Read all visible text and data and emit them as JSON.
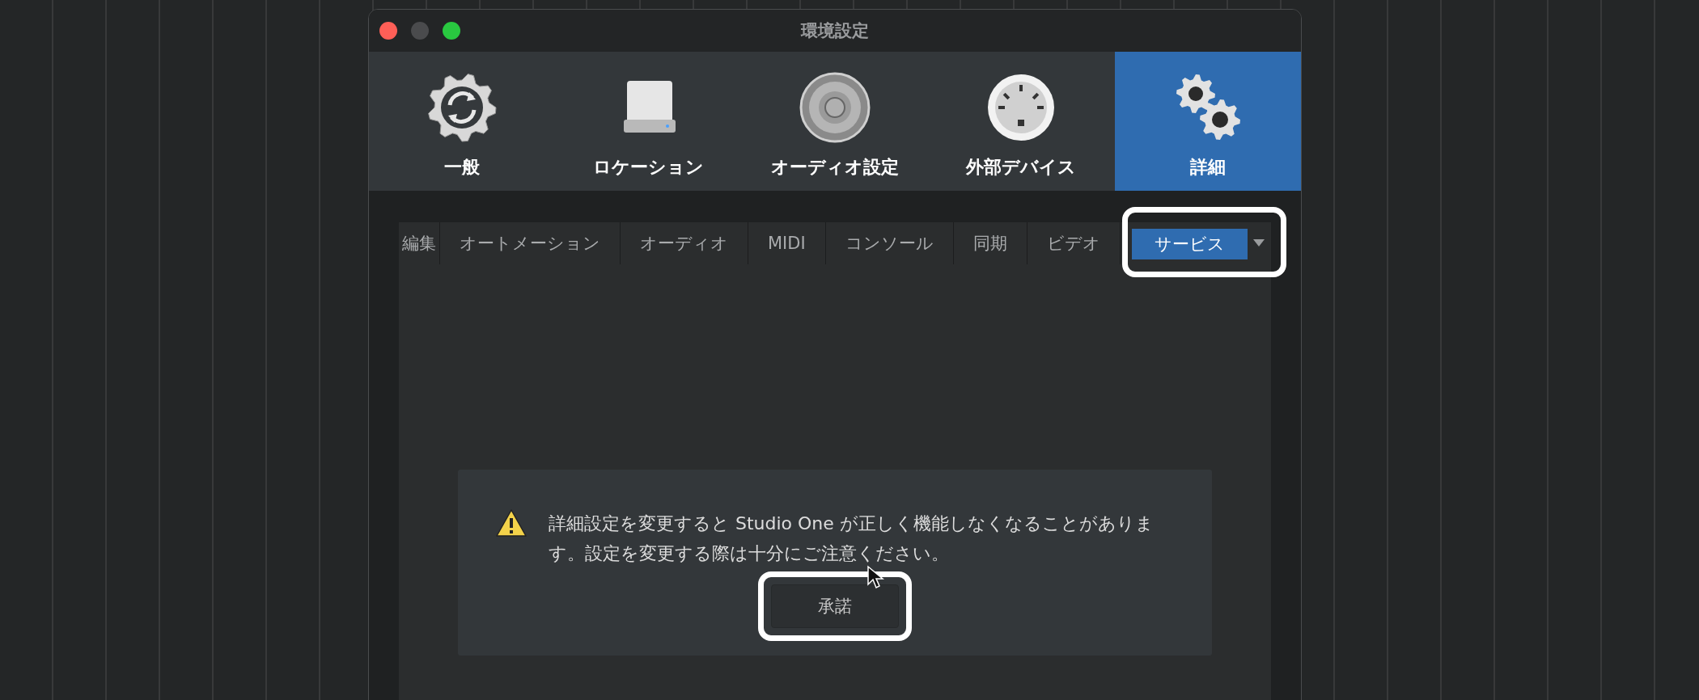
{
  "window": {
    "title": "環境設定"
  },
  "categories": [
    {
      "label": "一般",
      "kind": "general",
      "selected": false
    },
    {
      "label": "ロケーション",
      "kind": "locations",
      "selected": false
    },
    {
      "label": "オーディオ設定",
      "kind": "audio",
      "selected": false
    },
    {
      "label": "外部デバイス",
      "kind": "devices",
      "selected": false
    },
    {
      "label": "詳細",
      "kind": "advanced",
      "selected": true
    }
  ],
  "subtabs": [
    {
      "label": "編集",
      "selected": false,
      "highlighted": false
    },
    {
      "label": "オートメーション",
      "selected": false,
      "highlighted": false
    },
    {
      "label": "オーディオ",
      "selected": false,
      "highlighted": false
    },
    {
      "label": "MIDI",
      "selected": false,
      "highlighted": false
    },
    {
      "label": "コンソール",
      "selected": false,
      "highlighted": false
    },
    {
      "label": "同期",
      "selected": false,
      "highlighted": false
    },
    {
      "label": "ビデオ",
      "selected": false,
      "highlighted": false
    },
    {
      "label": "サービス",
      "selected": true,
      "highlighted": true
    }
  ],
  "notice": {
    "message": "詳細設定を変更すると Studio One が正しく機能しなくなることがあります。設定を変更する際は十分にご注意ください。",
    "button": {
      "label": "承諾",
      "highlighted": true
    }
  }
}
